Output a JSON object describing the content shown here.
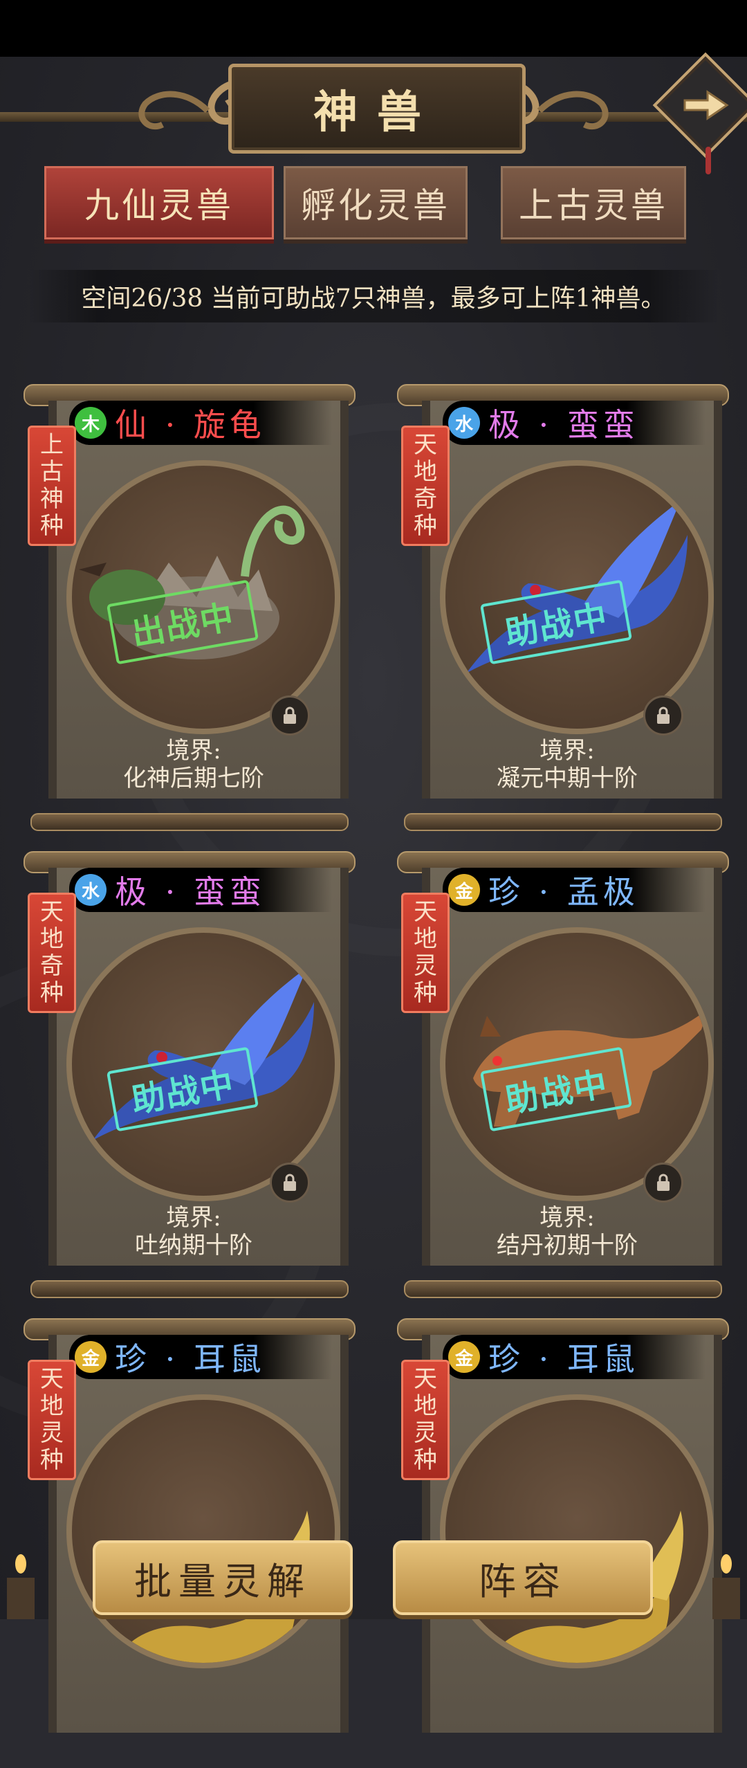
{
  "header": {
    "title": "神兽"
  },
  "tabs": [
    {
      "label": "九仙灵兽",
      "active": true
    },
    {
      "label": "孵化灵兽",
      "active": false
    },
    {
      "label": "上古灵兽",
      "active": false
    }
  ],
  "info_text": "空间26/38  当前可助战7只神兽，最多可上阵1神兽。",
  "beasts": [
    {
      "grade": "仙",
      "name": "仙 · 旋龟",
      "element": "木",
      "element_color": "#3fbf3f",
      "name_color": "#ff4d4d",
      "badge": [
        "上",
        "古",
        "神",
        "种"
      ],
      "status": "出战中",
      "status_style": "green",
      "realm_label": "境界:",
      "realm": "化神后期七阶",
      "icon": "turtle-portrait-icon"
    },
    {
      "grade": "极",
      "name": "极 · 蛮蛮",
      "element": "水",
      "element_color": "#4aa3e8",
      "name_color": "#e27bea",
      "badge": [
        "天",
        "地",
        "奇",
        "种"
      ],
      "status": "助战中",
      "status_style": "teal",
      "realm_label": "境界:",
      "realm": "凝元中期十阶",
      "icon": "blue-bird-portrait-icon"
    },
    {
      "grade": "极",
      "name": "极 · 蛮蛮",
      "element": "水",
      "element_color": "#4aa3e8",
      "name_color": "#e27bea",
      "badge": [
        "天",
        "地",
        "奇",
        "种"
      ],
      "status": "助战中",
      "status_style": "teal",
      "realm_label": "境界:",
      "realm": "吐纳期十阶",
      "icon": "blue-bird-portrait-icon"
    },
    {
      "grade": "珍",
      "name": "珍 · 孟极",
      "element": "金",
      "element_color": "#e0b12a",
      "name_color": "#7fb7ff",
      "badge": [
        "天",
        "地",
        "灵",
        "种"
      ],
      "status": "助战中",
      "status_style": "teal",
      "realm_label": "境界:",
      "realm": "结丹初期十阶",
      "icon": "leopard-portrait-icon"
    },
    {
      "grade": "珍",
      "name": "珍 · 耳鼠",
      "element": "金",
      "element_color": "#e0b12a",
      "name_color": "#7fb7ff",
      "badge": [
        "天",
        "地",
        "灵",
        "种"
      ],
      "status": "",
      "status_style": "",
      "realm_label": "",
      "realm": "",
      "icon": "mouse-portrait-icon"
    },
    {
      "grade": "珍",
      "name": "珍 · 耳鼠",
      "element": "金",
      "element_color": "#e0b12a",
      "name_color": "#7fb7ff",
      "badge": [
        "天",
        "地",
        "灵",
        "种"
      ],
      "status": "",
      "status_style": "",
      "realm_label": "",
      "realm": "",
      "icon": "mouse-portrait-icon"
    }
  ],
  "bottom_buttons": {
    "batch": "批量灵解",
    "lineup": "阵容"
  }
}
